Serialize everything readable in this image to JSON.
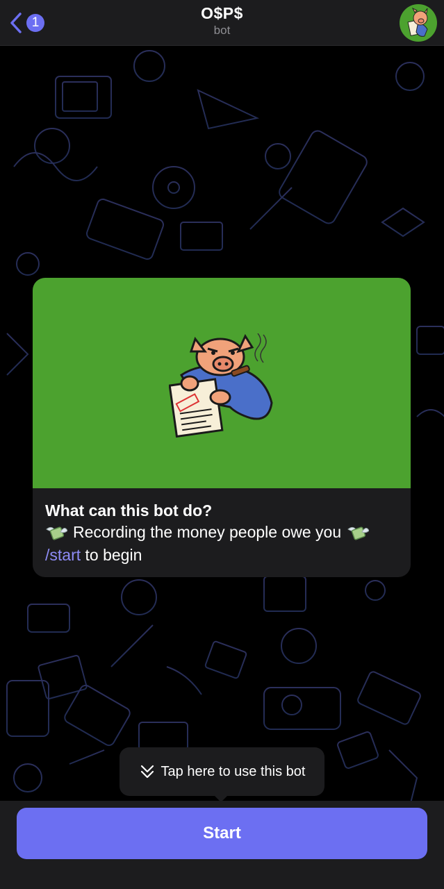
{
  "header": {
    "back_icon": "chevron-left-icon",
    "unread_count": "1",
    "title": "O$P$",
    "subtitle": "bot",
    "avatar_icon": "pig-mascot-avatar"
  },
  "intro_card": {
    "media_icon": "pig-with-invoice-illustration",
    "heading": "What can this bot do?",
    "description": "Recording the money people owe you",
    "emoji_icon": "money-with-wings-icon",
    "command": "/start",
    "command_suffix": " to begin"
  },
  "tooltip": {
    "icon": "double-chevron-down-icon",
    "text": "Tap here to use this bot"
  },
  "start_button": {
    "label": "Start"
  },
  "colors": {
    "accent": "#6c6ff2",
    "link": "#8e8cf6",
    "media_background": "#4ca22f",
    "panel": "#1c1c1e"
  }
}
